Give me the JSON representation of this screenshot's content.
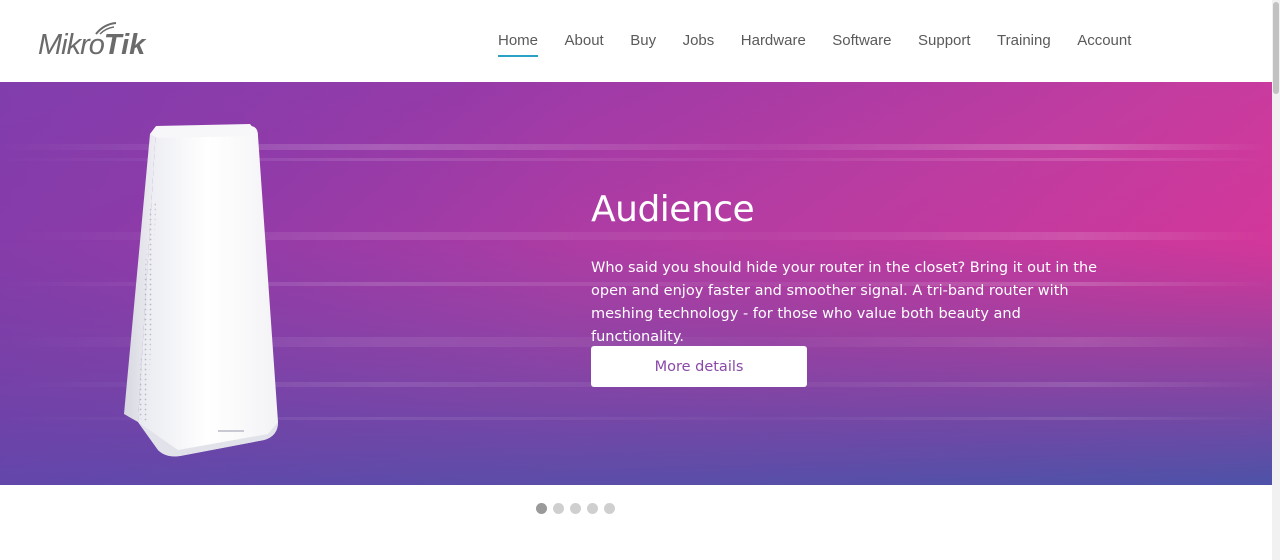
{
  "logo": {
    "part1": "Mikro",
    "part2": "Tik"
  },
  "nav": {
    "items": [
      {
        "label": "Home",
        "active": true
      },
      {
        "label": "About"
      },
      {
        "label": "Buy"
      },
      {
        "label": "Jobs"
      },
      {
        "label": "Hardware"
      },
      {
        "label": "Software"
      },
      {
        "label": "Support"
      },
      {
        "label": "Training"
      },
      {
        "label": "Account"
      }
    ],
    "active_underline_color": "#2aa2c7"
  },
  "hero": {
    "title": "Audience",
    "description": "Who said you should hide your router in the closet? Bring it out in the open and enjoy faster and smoother signal. A tri-band router with meshing technology - for those who value both beauty and functionality.",
    "button_label": "More details",
    "button_text_color": "#8a49a8",
    "product_image": "router-image"
  },
  "carousel": {
    "total": 5,
    "active_index": 0
  }
}
